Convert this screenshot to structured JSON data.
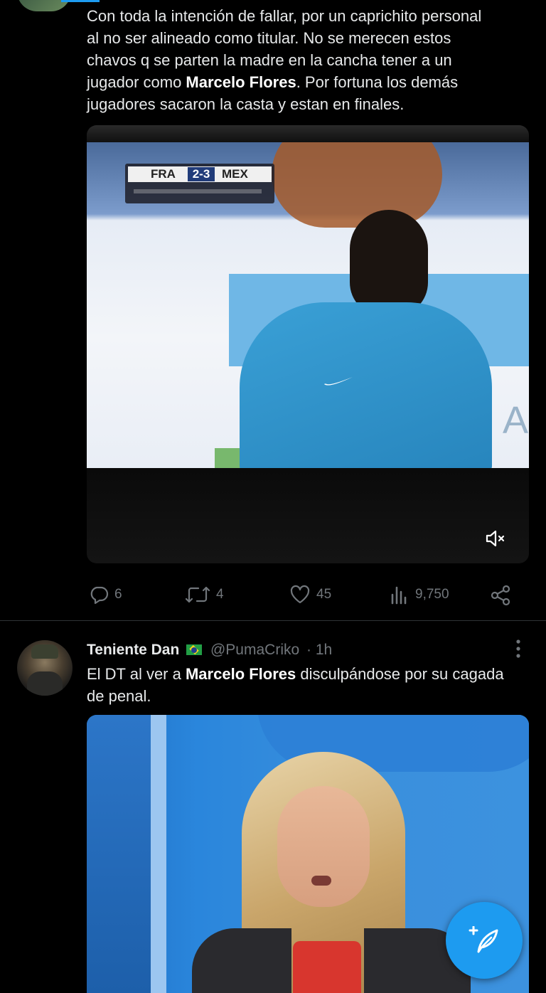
{
  "tweet1": {
    "text_lines": [
      [
        "Con toda la intención de fallar, por un caprichito personal"
      ],
      [
        "al no ser alineado como titular. No se merecen estos"
      ],
      [
        "chavos q se parten la madre en la cancha tener a un"
      ],
      [
        "jugador como ",
        "Marcelo Flores",
        ". Por fortuna los demás"
      ],
      [
        "jugadores sacaron la casta y estan en finales."
      ]
    ],
    "scoreboard": {
      "home": "FRA",
      "score": "2-3",
      "away": "MEX"
    },
    "actions": {
      "replies": "6",
      "retweets": "4",
      "likes": "45",
      "views": "9,750"
    }
  },
  "tweet2": {
    "display_name": "Teniente Dan",
    "flag": "🇧🇷",
    "handle": "@PumaCriko",
    "time": "· 1h",
    "text_line1_pre": "El DT al ver a ",
    "text_line1_bold": "Marcelo Flores",
    "text_line1_post": " disculpándose por su cagada",
    "text_line2": "de penal."
  },
  "icons": [
    "reply-icon",
    "retweet-icon",
    "like-icon",
    "views-icon",
    "share-icon",
    "mute-icon",
    "more-icon",
    "compose-icon"
  ],
  "colors": {
    "accent": "#1d9bf0",
    "muted": "#71767b",
    "background": "#000000"
  }
}
